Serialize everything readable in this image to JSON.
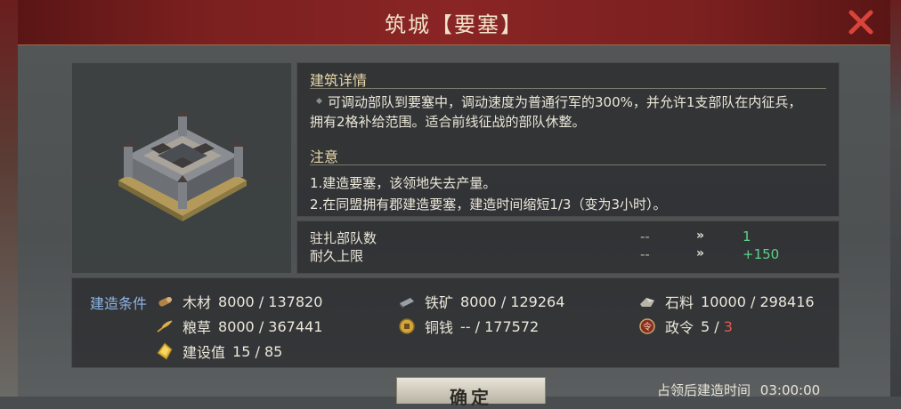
{
  "window": {
    "title": "筑城【要塞】"
  },
  "detail": {
    "section_title": "建筑详情",
    "description_line1": "可调动部队到要塞中，调动速度为普通行军的300%，并允许1支部队在内征兵，",
    "description_line2": "拥有2格补给范围。适合前线征战的部队休整。",
    "notes_title": "注意",
    "note1": "1.建造要塞，该领地失去产量。",
    "note2": "2.在同盟拥有郡建造要塞，建造时间缩短1/3（变为3小时）。"
  },
  "stats": [
    {
      "label": "驻扎部队数",
      "old": "--",
      "arrow": "»",
      "new": "1"
    },
    {
      "label": "耐久上限",
      "old": "--",
      "arrow": "»",
      "new": "+150"
    }
  ],
  "conditions": {
    "label": "建造条件",
    "wood": {
      "name": "木材",
      "value": "8000 / 137820",
      "icon": "wood-icon"
    },
    "iron": {
      "name": "铁矿",
      "value": "8000 / 129264",
      "icon": "iron-icon"
    },
    "stone": {
      "name": "石料",
      "value": "10000 / 298416",
      "icon": "stone-icon"
    },
    "grain": {
      "name": "粮草",
      "value": "8000 / 367441",
      "icon": "grain-icon"
    },
    "copper": {
      "name": "铜钱",
      "value": "-- / 177572",
      "icon": "coin-icon"
    },
    "order": {
      "name": "政令",
      "have": "5",
      "sep": " / ",
      "need": "3",
      "icon": "order-icon"
    },
    "build": {
      "name": "建设值",
      "value": "15 / 85",
      "icon": "build-value-icon"
    }
  },
  "footer": {
    "confirm_label": "确定",
    "time_label": "占领后建造时间",
    "time_value": "03:00:00"
  },
  "colors": {
    "accent_green": "#5ed28a",
    "accent_red": "#e05a4e",
    "label_blue": "#8fb6e6",
    "title_bar": "#7a1f1f"
  }
}
